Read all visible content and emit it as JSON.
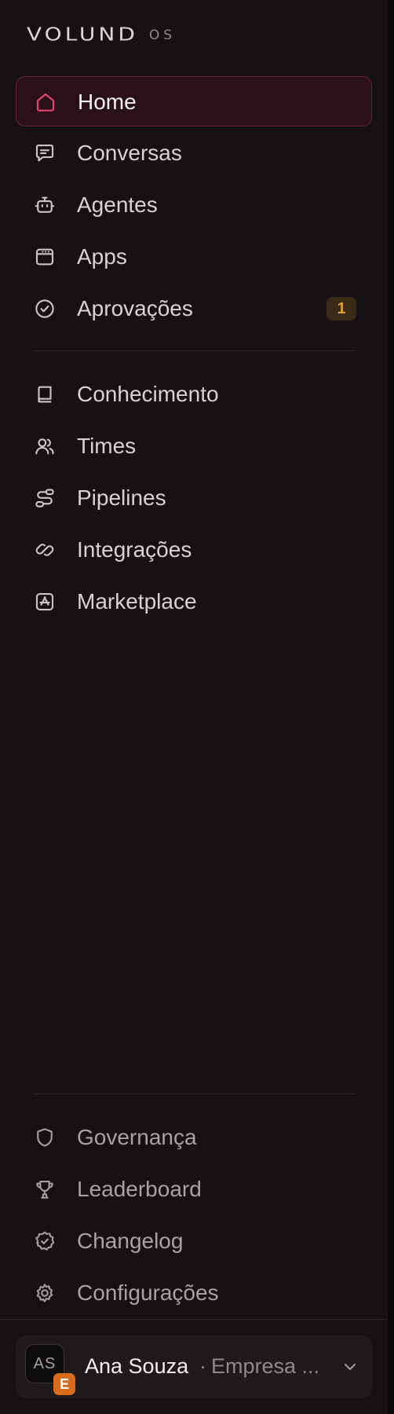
{
  "brand": {
    "name": "VOLUND",
    "suffix": "OS"
  },
  "nav_primary": [
    {
      "label": "Home",
      "icon": "home-icon",
      "active": true
    },
    {
      "label": "Conversas",
      "icon": "chat-icon"
    },
    {
      "label": "Agentes",
      "icon": "bot-icon"
    },
    {
      "label": "Apps",
      "icon": "app-window-icon"
    },
    {
      "label": "Aprovações",
      "icon": "check-circle-icon",
      "badge": "1"
    }
  ],
  "nav_secondary": [
    {
      "label": "Conhecimento",
      "icon": "book-icon"
    },
    {
      "label": "Times",
      "icon": "users-icon"
    },
    {
      "label": "Pipelines",
      "icon": "route-icon"
    },
    {
      "label": "Integrações",
      "icon": "link-icon"
    },
    {
      "label": "Marketplace",
      "icon": "app-store-icon"
    }
  ],
  "nav_footer": [
    {
      "label": "Governança",
      "icon": "shield-icon"
    },
    {
      "label": "Leaderboard",
      "icon": "trophy-icon"
    },
    {
      "label": "Changelog",
      "icon": "badge-check-icon"
    },
    {
      "label": "Configurações",
      "icon": "settings-icon"
    }
  ],
  "user": {
    "initials": "AS",
    "workspace_badge": "E",
    "name": "Ana Souza",
    "separator": "·",
    "company": "Empresa ..."
  },
  "colors": {
    "accent": "#e8456f",
    "badge_text": "#e59b2d",
    "workspace_badge": "#d96b1c",
    "sidebar_bg": "#151114"
  }
}
